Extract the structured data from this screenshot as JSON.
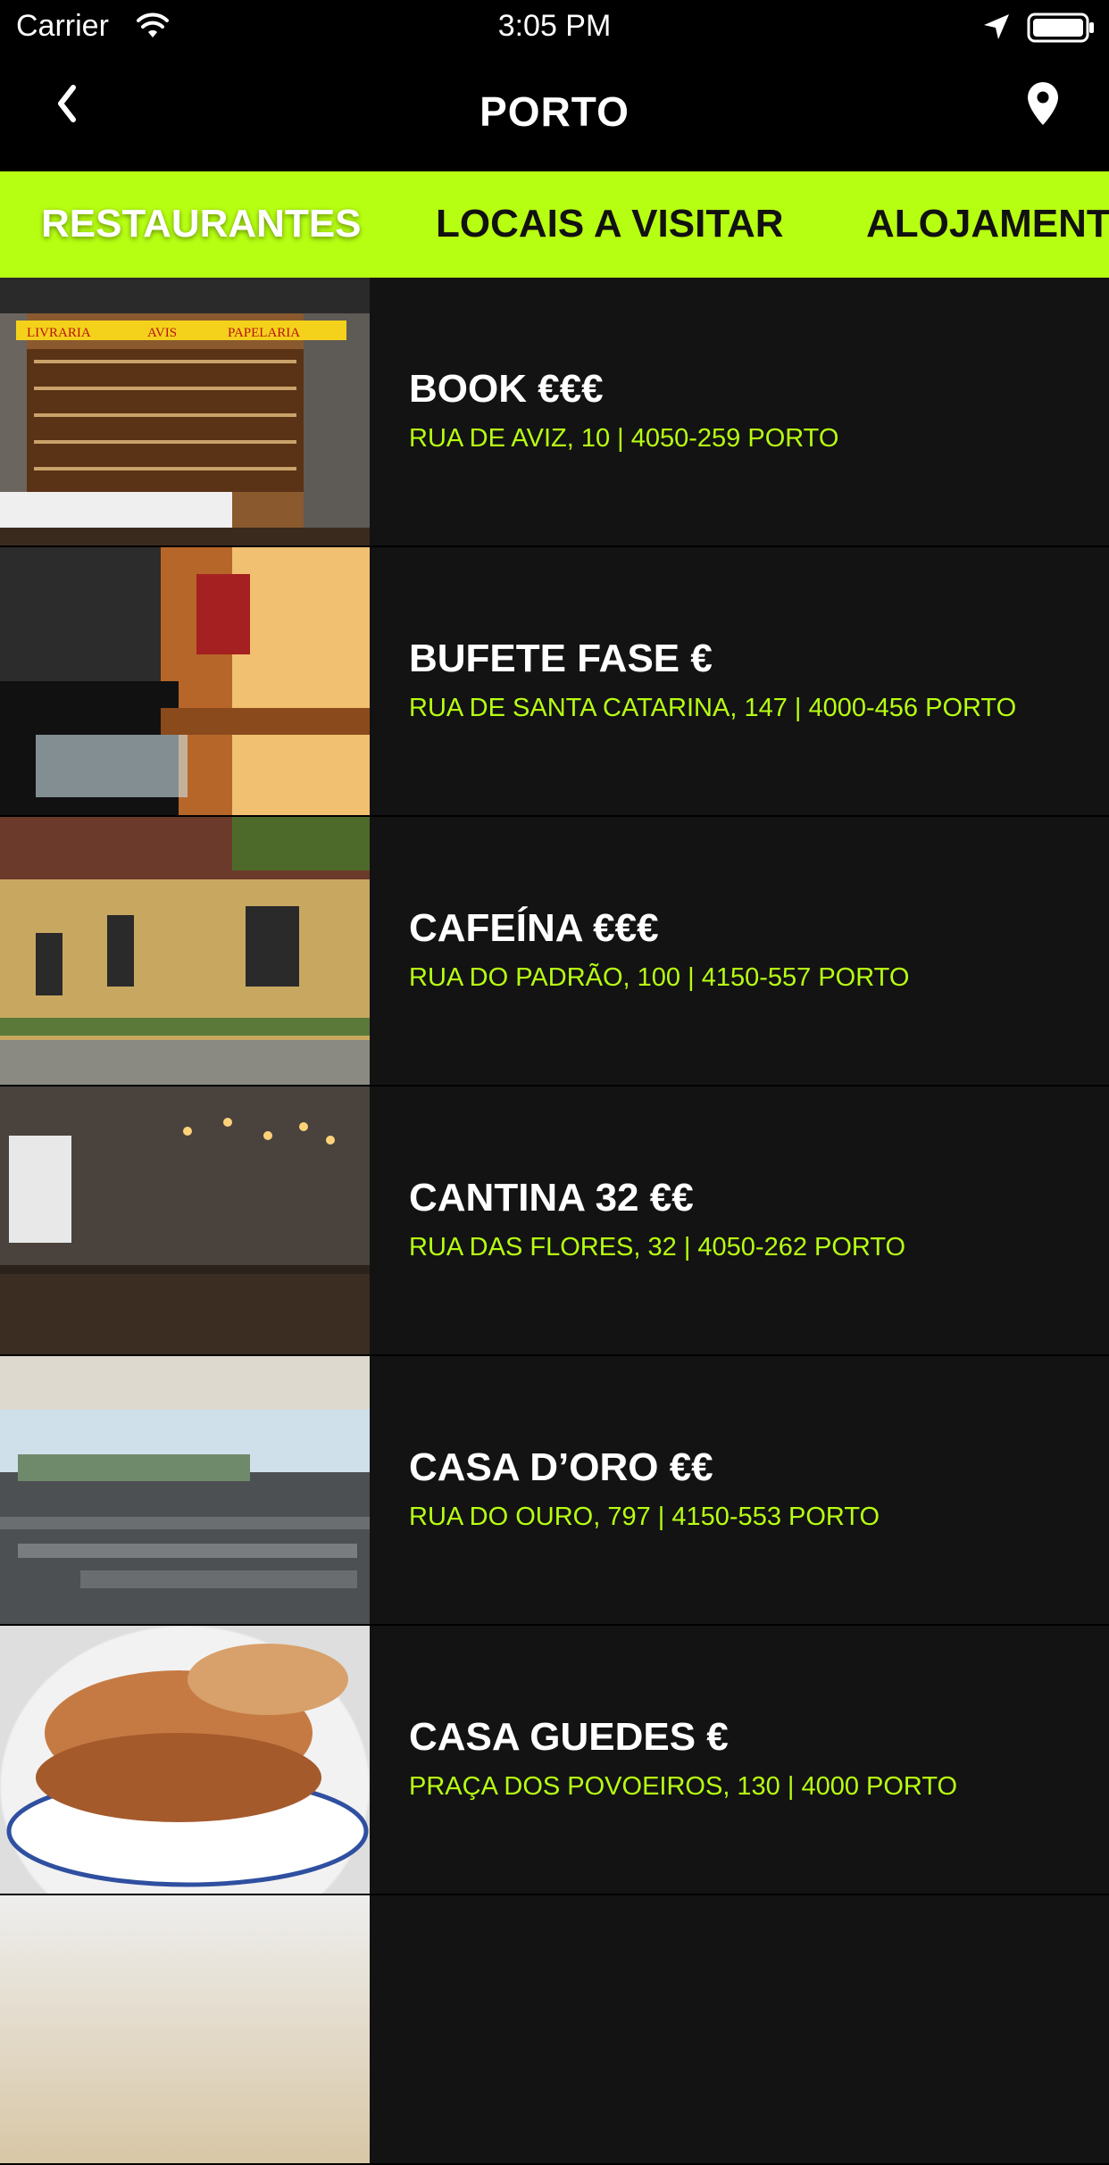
{
  "status_bar": {
    "carrier": "Carrier",
    "time": "3:05 PM",
    "wifi_icon": "wifi-icon",
    "location_icon": "location-arrow-icon",
    "battery_icon": "battery-full-icon"
  },
  "nav": {
    "title": "PORTO",
    "back_icon": "chevron-left-icon",
    "map_icon": "map-pin-icon"
  },
  "tabs": [
    {
      "label": "RESTAURANTES",
      "active": true
    },
    {
      "label": "LOCAIS A VISITAR",
      "active": false
    },
    {
      "label": "ALOJAMENT",
      "active": false
    }
  ],
  "restaurants": [
    {
      "name": "BOOK €€€",
      "address": "RUA DE AVIZ, 10 | 4050-259 PORTO"
    },
    {
      "name": "BUFETE FASE €",
      "address": "RUA DE SANTA CATARINA, 147 | 4000-456 PORTO"
    },
    {
      "name": "CAFEÍNA €€€",
      "address": "RUA DO PADRÃO, 100 | 4150-557 PORTO"
    },
    {
      "name": "CANTINA 32 €€",
      "address": "RUA DAS FLORES, 32 | 4050-262 PORTO"
    },
    {
      "name": "CASA D’ORO €€",
      "address": "RUA DO OURO, 797 | 4150-553 PORTO"
    },
    {
      "name": "CASA GUEDES €",
      "address": "PRAÇA DOS POVOEIROS, 130 | 4000 PORTO"
    }
  ],
  "thumbnail_signs": {
    "book_left": "LIVRARIA",
    "book_mid": "AVIS",
    "book_right": "PAPELARIA"
  },
  "colors": {
    "accent": "#b7ff12",
    "background": "#131313",
    "bar": "#000000"
  }
}
